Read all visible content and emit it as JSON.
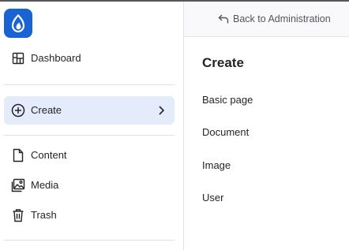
{
  "sidebar": {
    "logo": {
      "icon": "drupal-drop-icon",
      "color": "#1a63d3"
    },
    "items": [
      {
        "label": "Dashboard",
        "icon": "dashboard-icon"
      },
      {
        "label": "Create",
        "icon": "plus-circle-icon",
        "active": true,
        "chevron": "chevron-right-icon"
      },
      {
        "label": "Content",
        "icon": "file-icon"
      },
      {
        "label": "Media",
        "icon": "image-icon"
      },
      {
        "label": "Trash",
        "icon": "trash-icon"
      }
    ]
  },
  "panel": {
    "back": {
      "label": "Back to Administration",
      "icon": "arrow-back-icon"
    },
    "title": "Create",
    "links": [
      "Basic page",
      "Document",
      "Image",
      "User"
    ]
  },
  "colors": {
    "accent": "#1a63d3",
    "active_bg": "#e4ebfb",
    "text": "#232429"
  }
}
